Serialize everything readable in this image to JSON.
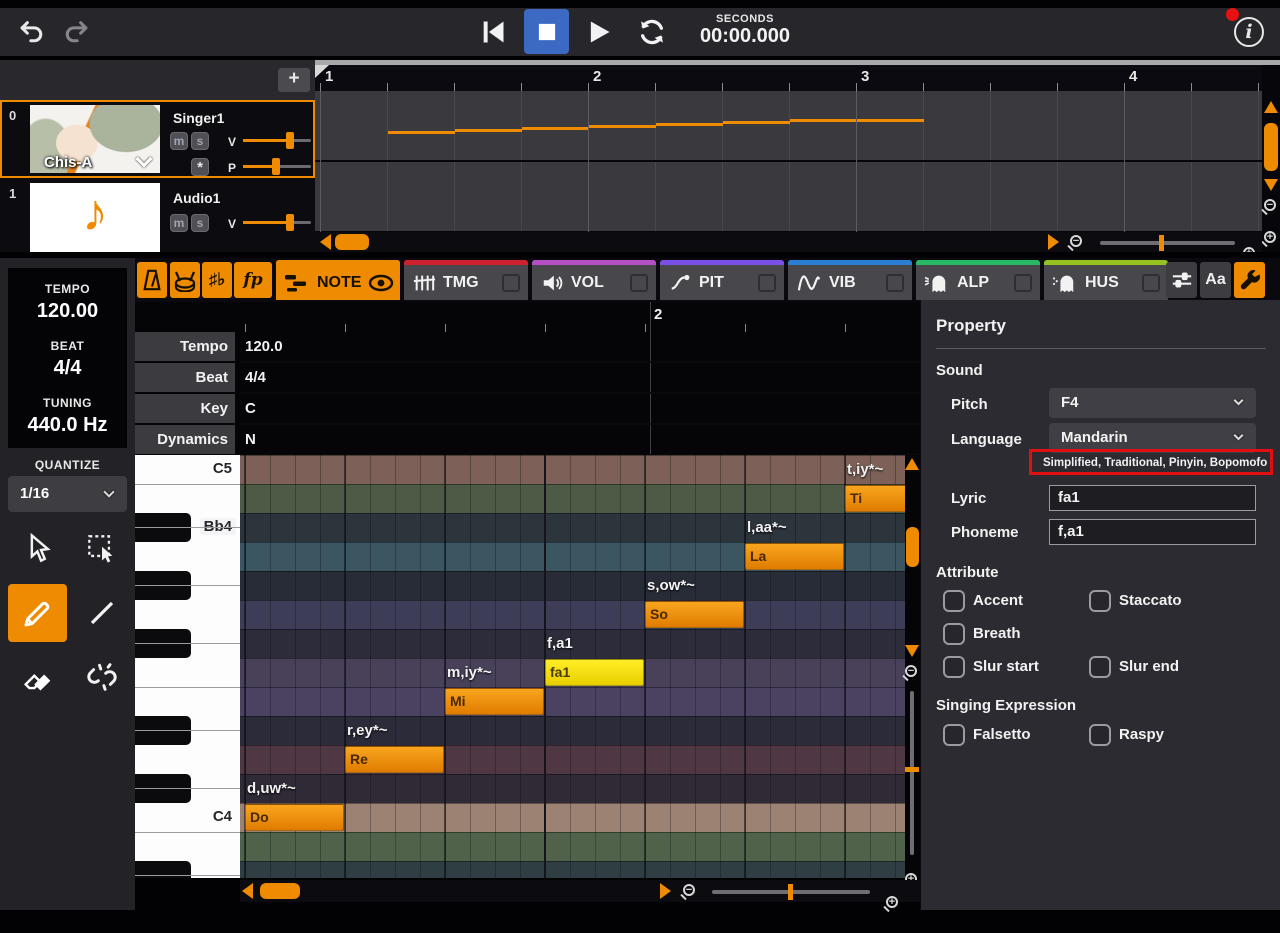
{
  "transport": {
    "seconds_label": "SECONDS",
    "time_value": "00:00.000",
    "undo_icon": "undo",
    "redo_icon": "redo",
    "skip_start_icon": "skip-to-start",
    "stop_icon": "stop",
    "play_icon": "play",
    "loop_icon": "loop",
    "info_glyph": "i",
    "stop_active_color": "#3c6ac2",
    "notification_color": "#e81111"
  },
  "track_panel": {
    "add_button": "+",
    "tracks": [
      {
        "index": "0",
        "name": "Singer1",
        "voice": "Chis-A",
        "mute": "m",
        "solo": "s",
        "volume_label": "V",
        "pan_label": "P",
        "star": "*",
        "selected": true
      },
      {
        "index": "1",
        "name": "Audio1",
        "mute": "m",
        "solo": "s",
        "volume_label": "V",
        "note_glyph": "♪"
      }
    ]
  },
  "arrangement": {
    "measures": [
      "1",
      "2",
      "3",
      "4"
    ],
    "accent_color": "#ef8b00"
  },
  "sidebar": {
    "tempo_label": "TEMPO",
    "tempo_value": "120.00",
    "beat_label": "BEAT",
    "beat_value": "4/4",
    "tuning_label": "TUNING",
    "tuning_value": "440.0 Hz",
    "quantize_label": "QUANTIZE",
    "quantize_value": "1/16",
    "tools": [
      {
        "name": "select-cursor",
        "active": false
      },
      {
        "name": "marquee-select",
        "active": false
      },
      {
        "name": "pencil",
        "active": true
      },
      {
        "name": "line",
        "active": false
      },
      {
        "name": "eraser",
        "active": false
      },
      {
        "name": "unlink",
        "active": false
      }
    ]
  },
  "tabs": {
    "mini_buttons": [
      {
        "name": "metronome",
        "icon": "metronome"
      },
      {
        "name": "drum",
        "icon": "drum"
      },
      {
        "name": "accidentals",
        "label": "♯♭"
      },
      {
        "name": "dynamics",
        "label": "fp"
      }
    ],
    "items": [
      {
        "label": "NOTE",
        "color": "#ef8b00",
        "icon": "note",
        "active": true,
        "eye": true
      },
      {
        "label": "TMG",
        "color": "#cf2030",
        "icon": "timing",
        "checkbox": true
      },
      {
        "label": "VOL",
        "color": "#b44fc4",
        "icon": "volume",
        "checkbox": true
      },
      {
        "label": "PIT",
        "color": "#7a4fe8",
        "icon": "pitch",
        "checkbox": true
      },
      {
        "label": "VIB",
        "color": "#2a7fd4",
        "icon": "vibrato",
        "checkbox": true
      },
      {
        "label": "ALP",
        "color": "#28b964",
        "icon": "ghost-alp",
        "checkbox": true
      },
      {
        "label": "HUS",
        "color": "#95c220",
        "icon": "ghost-hus",
        "checkbox": true
      }
    ],
    "right_buttons": [
      {
        "name": "mixer",
        "icon": "mixer",
        "active": false
      },
      {
        "name": "font-size",
        "label": "Aa",
        "active": false
      },
      {
        "name": "settings-wrench",
        "icon": "wrench",
        "active": true
      }
    ]
  },
  "params": {
    "ruler_measure": "2",
    "rows": [
      {
        "label": "Tempo",
        "value": "120.0"
      },
      {
        "label": "Beat",
        "value": "4/4"
      },
      {
        "label": "Key",
        "value": "C"
      },
      {
        "label": "Dynamics",
        "value": "N"
      }
    ]
  },
  "piano_roll": {
    "rows": [
      {
        "pitch": "C5",
        "color": "#7d6158",
        "key": "white",
        "label": "C5"
      },
      {
        "pitch": "B4",
        "color": "#4d5a45",
        "key": "white"
      },
      {
        "pitch": "Bb4",
        "color": "#2c343c",
        "key": "black",
        "label": "Bb4"
      },
      {
        "pitch": "A4",
        "color": "#3c5661",
        "key": "white"
      },
      {
        "pitch": "Ab4",
        "color": "#272c37",
        "key": "black"
      },
      {
        "pitch": "G4",
        "color": "#3e3d57",
        "key": "white"
      },
      {
        "pitch": "F#4",
        "color": "#2c2c3b",
        "key": "black"
      },
      {
        "pitch": "F4",
        "color": "#484159",
        "key": "white"
      },
      {
        "pitch": "E4",
        "color": "#4b4261",
        "key": "white"
      },
      {
        "pitch": "Eb4",
        "color": "#2c2b39",
        "key": "black"
      },
      {
        "pitch": "D4",
        "color": "#4f3843",
        "key": "white"
      },
      {
        "pitch": "C#4",
        "color": "#2f2a36",
        "key": "black"
      },
      {
        "pitch": "C4",
        "color": "#9c8273",
        "key": "white",
        "label": "C4"
      },
      {
        "pitch": "B3",
        "color": "#50634a",
        "key": "white"
      },
      {
        "pitch": "Bb3",
        "color": "#2f3e43",
        "key": "black"
      }
    ],
    "notes": [
      {
        "syllable": "Do",
        "phoneme": "d,uw*~",
        "beat": 0,
        "len": 1,
        "row": 12,
        "selected": false
      },
      {
        "syllable": "Re",
        "phoneme": "r,ey*~",
        "beat": 1,
        "len": 1,
        "row": 10,
        "selected": false
      },
      {
        "syllable": "Mi",
        "phoneme": "m,iy*~",
        "beat": 2,
        "len": 1,
        "row": 8,
        "selected": false
      },
      {
        "syllable": "fa1",
        "phoneme": "f,a1",
        "beat": 3,
        "len": 1,
        "row": 7,
        "selected": true
      },
      {
        "syllable": "So",
        "phoneme": "s,ow*~",
        "beat": 4,
        "len": 1,
        "row": 5,
        "selected": false
      },
      {
        "syllable": "La",
        "phoneme": "l,aa*~",
        "beat": 5,
        "len": 1,
        "row": 3,
        "selected": false
      },
      {
        "syllable": "Ti",
        "phoneme": "t,iy*~",
        "beat": 6,
        "len": 2,
        "row": 1,
        "selected": false
      }
    ],
    "note_color": "#ef8b00",
    "selected_note_color": "#f6e80a"
  },
  "property_panel": {
    "title": "Property",
    "sound_section": "Sound",
    "pitch_label": "Pitch",
    "pitch_value": "F4",
    "language_label": "Language",
    "language_value": "Mandarin",
    "language_scripts": "Simplified, Traditional, Pinyin, Bopomofo",
    "highlight_box_color": "#e01010",
    "lyric_label": "Lyric",
    "lyric_value": "fa1",
    "phoneme_label": "Phoneme",
    "phoneme_value": "f,a1",
    "attribute_section": "Attribute",
    "attribute_rows": [
      [
        "Accent",
        "Staccato"
      ],
      [
        "Breath"
      ],
      [
        "Slur start",
        "Slur end"
      ]
    ],
    "expression_section": "Singing Expression",
    "expression_rows": [
      [
        "Falsetto",
        "Raspy"
      ]
    ]
  }
}
